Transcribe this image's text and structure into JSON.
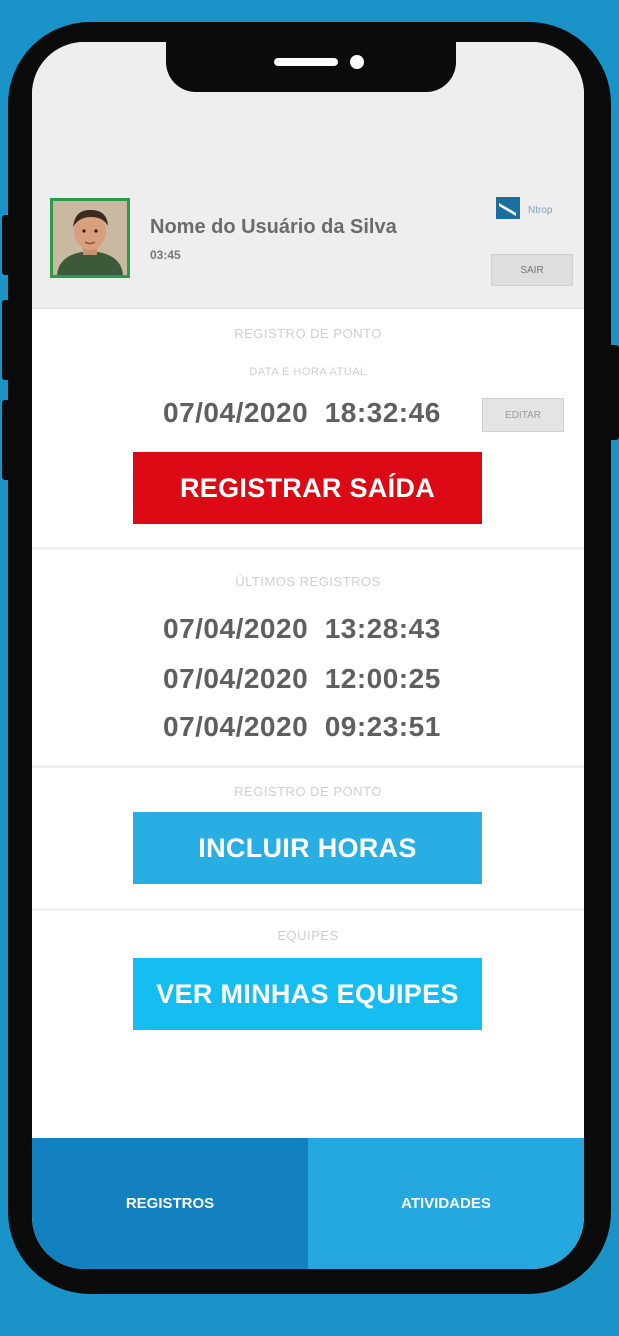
{
  "header": {
    "user_name": "Nome do Usuário da Silva",
    "user_time": "03:45",
    "logo_text": "Ntrop",
    "sair_label": "SAIR"
  },
  "registro": {
    "section_title": "REGISTRO DE PONTO",
    "current_label": "DATA E HORA ATUAL",
    "current_datetime": "07/04/2020  18:32:46",
    "edit_label": "EDITAR",
    "action_label": "REGISTRAR SAÍDA"
  },
  "ultimos": {
    "section_title": "ÚLTIMOS REGISTROS",
    "entries": [
      "07/04/2020  13:28:43",
      "07/04/2020  12:00:25",
      "07/04/2020  09:23:51"
    ]
  },
  "incluir": {
    "section_title": "REGISTRO DE PONTO",
    "action_label": "INCLUIR HORAS"
  },
  "equipes": {
    "section_title": "EQUIPES",
    "action_label": "VER MINHAS EQUIPES"
  },
  "tabs": [
    {
      "label": "REGISTROS",
      "active": true
    },
    {
      "label": "ATIVIDADES",
      "active": false
    }
  ],
  "colors": {
    "background": "#1a93c9",
    "danger": "#dc0a14",
    "primary": "#29aee3",
    "secondary": "#16bdf0",
    "tab_active": "#1380c0",
    "tab_inactive": "#24a8df"
  }
}
